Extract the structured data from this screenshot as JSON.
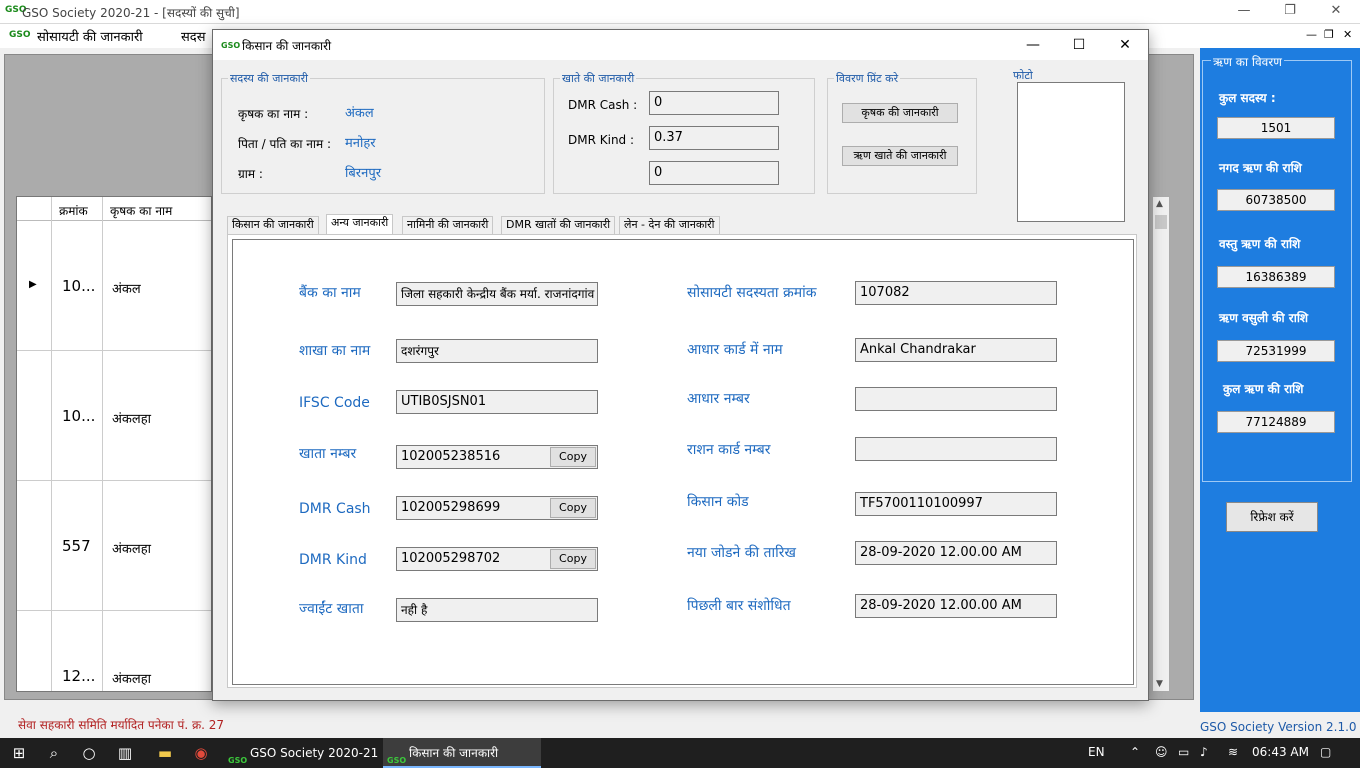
{
  "main_window": {
    "title": "GSO Society 2020-21 - [सदस्यों की सुची]",
    "logo_text": "GSO",
    "menu": [
      "सोसायटी की जानकारी",
      "सदस"
    ]
  },
  "grid": {
    "columns": [
      "क्रमांक",
      "कृषक का नाम"
    ],
    "rows": [
      {
        "num": "10...",
        "name": "अंकल"
      },
      {
        "num": "10...",
        "name": "अंकलहा"
      },
      {
        "num": "557",
        "name": "अंकलहा"
      },
      {
        "num": "12...",
        "name": "अंकलहा"
      }
    ]
  },
  "side_panel": {
    "title": "ऋण का विवरण",
    "items": [
      {
        "label": "कुल सदस्य :",
        "value": "1501"
      },
      {
        "label": "नगद ऋण की राशि",
        "value": "60738500"
      },
      {
        "label": "वस्तु ऋण की राशि",
        "value": "16386389"
      },
      {
        "label": "ऋण वसुली की राशि",
        "value": "72531999"
      },
      {
        "label": "कुल ऋण की राशि",
        "value": "77124889"
      }
    ],
    "refresh_label": "रिफ्रेश करें"
  },
  "status": {
    "left": "सेवा सहकारी समिति मर्यादित पनेका पं. क्र. 27",
    "right": "GSO Society Version 2.1.0"
  },
  "dialog": {
    "title": "किसान की जानकारी",
    "member_info": {
      "title": "सदस्य की जानकारी",
      "name_label": "कृषक का नाम :",
      "name_value": "अंकल",
      "father_label": "पिता / पति का नाम :",
      "father_value": "मनोहर",
      "village_label": "ग्राम :",
      "village_value": "बिरनपुर"
    },
    "account_info": {
      "title": "खाते  की जानकारी",
      "cash_label": "DMR Cash :",
      "cash_value": "0",
      "kind_label": "DMR Kind :",
      "kind_value": "0.37",
      "third_value": "0"
    },
    "print_info": {
      "title": "विवरण प्रिंट करे",
      "btn_farmer": "कृषक की जानकारी",
      "btn_loan": "ऋण खाते की जानकारी"
    },
    "photo_title": "फोटो",
    "tabs": [
      "किसान की जानकारी",
      "अन्य जानकारी",
      "नामिनी की जानकारी",
      "DMR खातों की जानकारी",
      "लेन - देन की जानकारी"
    ],
    "selected_tab": "अन्य जानकारी",
    "copy_label": "Copy",
    "fields_left": [
      {
        "label": "बैंक का नाम",
        "value": "जिला सहकारी केन्द्रीय बैंक मर्या. राजनांदगांव"
      },
      {
        "label": "शाखा का नाम",
        "value": "दशरंगपुर"
      },
      {
        "label": "IFSC Code",
        "value": "UTIB0SJSN01"
      },
      {
        "label": "खाता नम्बर",
        "value": "102005238516"
      },
      {
        "label": "DMR Cash",
        "value": "102005298699"
      },
      {
        "label": "DMR Kind",
        "value": "102005298702"
      },
      {
        "label": "ज्वाईंट खाता",
        "value": "नही है"
      }
    ],
    "fields_right": [
      {
        "label": "सोसायटी सदस्यता क्रमांक",
        "value": "107082"
      },
      {
        "label": "आधार कार्ड में नाम",
        "value": "Ankal Chandrakar"
      },
      {
        "label": "आधार नम्बर",
        "value": ""
      },
      {
        "label": "राशन कार्ड नम्बर",
        "value": ""
      },
      {
        "label": "किसान कोड",
        "value": "TF5700110100997"
      },
      {
        "label": "नया जोडने की  तारिख",
        "value": "28-09-2020 12.00.00 AM"
      },
      {
        "label": "पिछली बार संशोधित",
        "value": "28-09-2020 12.00.00 AM"
      }
    ]
  },
  "taskbar": {
    "tasks": [
      "GSO Society 2020-21 ...",
      "किसान की जानकारी"
    ],
    "lang": "EN",
    "time": "06:43 AM"
  }
}
